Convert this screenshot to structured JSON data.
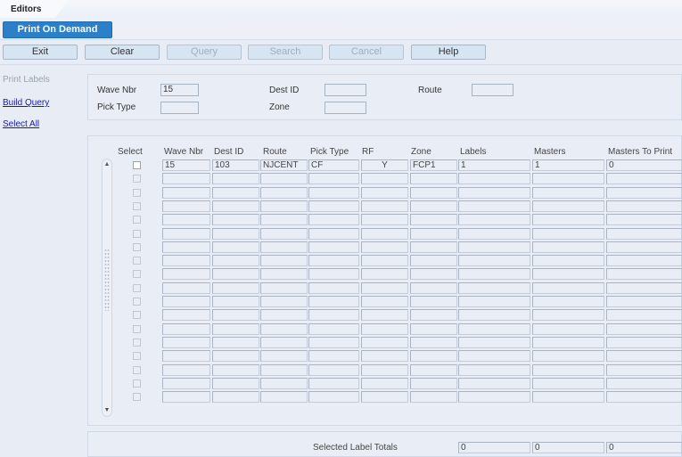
{
  "app": {
    "window_tab": "Editors",
    "screen_title": "Print On Demand"
  },
  "toolbar": {
    "buttons": [
      {
        "label": "Exit",
        "enabled": true
      },
      {
        "label": "Clear",
        "enabled": true
      },
      {
        "label": "Query",
        "enabled": false
      },
      {
        "label": "Search",
        "enabled": false
      },
      {
        "label": "Cancel",
        "enabled": false
      },
      {
        "label": "Help",
        "enabled": true
      }
    ]
  },
  "sidebar": {
    "header": "Print Labels",
    "links": [
      "Build Query",
      "Select All"
    ]
  },
  "query_form": {
    "wave_nbr": {
      "label": "Wave Nbr",
      "value": "15"
    },
    "pick_type": {
      "label": "Pick Type",
      "value": ""
    },
    "dest_id": {
      "label": "Dest ID",
      "value": ""
    },
    "zone": {
      "label": "Zone",
      "value": ""
    },
    "route": {
      "label": "Route",
      "value": ""
    }
  },
  "grid": {
    "columns": [
      "Select",
      "Wave Nbr",
      "Dest ID",
      "Route",
      "Pick Type",
      "RF",
      "Zone",
      "Labels",
      "Masters",
      "Masters To Print"
    ],
    "rows": [
      {
        "selected": false,
        "wave_nbr": "15",
        "dest_id": "103",
        "route": "NJCENT",
        "pick_type": "CF",
        "rf": "Y",
        "zone": "FCP1",
        "labels": "1",
        "masters": "1",
        "masters_to_print": "0"
      }
    ],
    "empty_row_count": 17
  },
  "totals": {
    "label": "Selected Label Totals",
    "labels": "0",
    "masters": "0",
    "masters_to_print": "0"
  },
  "icons": {
    "scroll_up": "▲",
    "scroll_down": "▼"
  }
}
